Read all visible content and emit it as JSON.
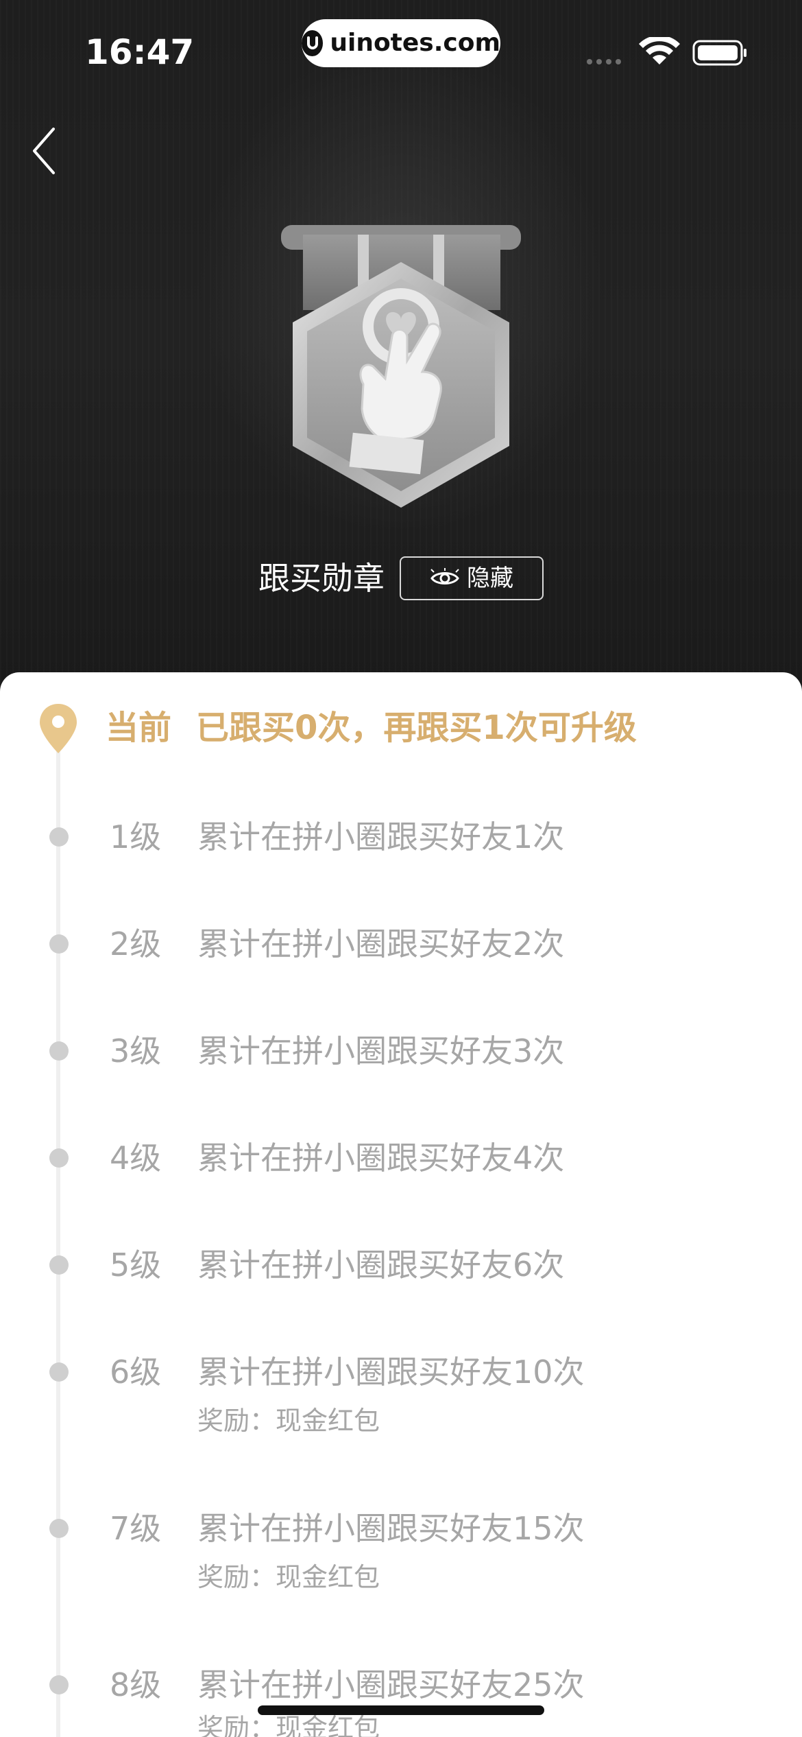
{
  "status_bar": {
    "time": "16:47",
    "url": "uinotes.com",
    "icons": [
      "signal-dots-icon",
      "wifi-icon",
      "battery-icon"
    ]
  },
  "header": {
    "back_icon": "chevron-left-icon"
  },
  "badge": {
    "title": "跟买勋章",
    "hide_label": "隐藏",
    "hide_icon": "eye-icon",
    "medal_icon": "crossed-fingers-heart-medal"
  },
  "progress": {
    "current_label": "当前",
    "current_text": "已跟买0次，再跟买1次可升级",
    "accent_color": "#d7ae6e"
  },
  "levels": [
    {
      "name": "1级",
      "desc": "累计在拼小圈跟买好友1次",
      "reward": ""
    },
    {
      "name": "2级",
      "desc": "累计在拼小圈跟买好友2次",
      "reward": ""
    },
    {
      "name": "3级",
      "desc": "累计在拼小圈跟买好友3次",
      "reward": ""
    },
    {
      "name": "4级",
      "desc": "累计在拼小圈跟买好友4次",
      "reward": ""
    },
    {
      "name": "5级",
      "desc": "累计在拼小圈跟买好友6次",
      "reward": ""
    },
    {
      "name": "6级",
      "desc": "累计在拼小圈跟买好友10次",
      "reward": "奖励：现金红包"
    },
    {
      "name": "7级",
      "desc": "累计在拼小圈跟买好友15次",
      "reward": "奖励：现金红包"
    },
    {
      "name": "8级",
      "desc": "累计在拼小圈跟买好友25次",
      "reward": "奖励：现金红包"
    }
  ]
}
